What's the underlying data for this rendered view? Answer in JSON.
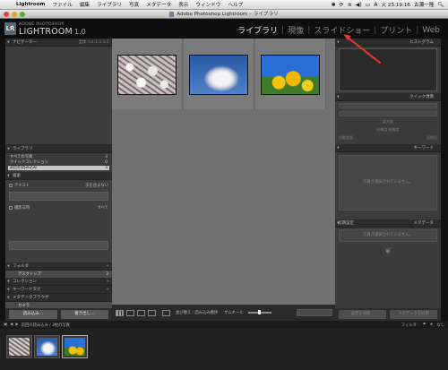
{
  "menubar": {
    "app": "Lightroom",
    "items": [
      "ファイル",
      "編集",
      "ライブラリ",
      "写真",
      "メタデータ",
      "表示",
      "ウィンドウ",
      "ヘルプ"
    ],
    "clock": "火 23:19:16",
    "user": "古瀬一隆"
  },
  "window": {
    "title": "Adobe Photoshop Lightroom – ライブラリ",
    "traffic": {
      "close": "#e0443e",
      "minimize": "#e6a823",
      "zoom": "#4fb33b"
    }
  },
  "identity": {
    "badge": "LR",
    "brand_top": "ADOBE PHOTOSHOP",
    "brand_main": "LIGHTROOM",
    "version": "1.0"
  },
  "modules": [
    {
      "label": "ライブラリ",
      "active": true
    },
    {
      "label": "現像",
      "active": false
    },
    {
      "label": "スライドショー",
      "active": false
    },
    {
      "label": "プリント",
      "active": false
    },
    {
      "label": "Web",
      "active": false
    }
  ],
  "left_panel": {
    "navigator": {
      "label": "ナビゲーター",
      "options": "全体  ﾌｨﾙ  1:1  3:1"
    },
    "library": {
      "label": "ライブラリ",
      "rows": [
        {
          "label": "すべての写真",
          "count": "3",
          "selected": false
        },
        {
          "label": "クイックコレクション",
          "count": "0",
          "selected": false
        },
        {
          "label": "前回の読み込み",
          "count": "3",
          "selected": true
        }
      ]
    },
    "find": {
      "label": "検索",
      "text_label": "テキスト",
      "text_option": "次を含まない",
      "date_label": "撮影日時",
      "date_option": "すべて"
    },
    "folders": {
      "label": "フォルダ",
      "item": "デスクトップ",
      "count": "3"
    },
    "collections": {
      "label": "コレクション"
    },
    "keyword_tags": {
      "label": "キーワードタグ"
    },
    "metadata_browser": {
      "label": "メタデータブラウザ",
      "item": "カメラ"
    },
    "import_button": "読み込み...",
    "export_button": "書き出し..."
  },
  "toolbar": {
    "sort_label": "並び替え : 読み込み順序",
    "thumb_label": "サムネール"
  },
  "right_panel": {
    "histogram": {
      "label": "ヒストグラム"
    },
    "quick_develop": {
      "label": "クイック現像",
      "preset": "プリセット",
      "wb": "ホワイトバランス",
      "exposure": "露光量",
      "recovery": "明瞭度 明瞭度",
      "auto": "自動階調",
      "reset": "初期化"
    },
    "keywording": {
      "label": "キーワード",
      "empty_text": "写真が選択されていません。"
    },
    "metadata": {
      "label": "メタデータ",
      "preset": "初期設定",
      "empty_text": "写真が選択されていません。"
    },
    "sync_button": "設定を同期...",
    "sync_meta_button": "メタデータを同期"
  },
  "filmstrip": {
    "source": "前回の読み込み / 3枚の写真",
    "filter_label": "フィルタ :",
    "filter_value": "なし"
  },
  "colors": {
    "photo1_sky": "#d9dde0",
    "photo2_sky": "#2f63b0",
    "photo3_sky": "#2a6fd6",
    "sunflower": "#f2c40c"
  }
}
